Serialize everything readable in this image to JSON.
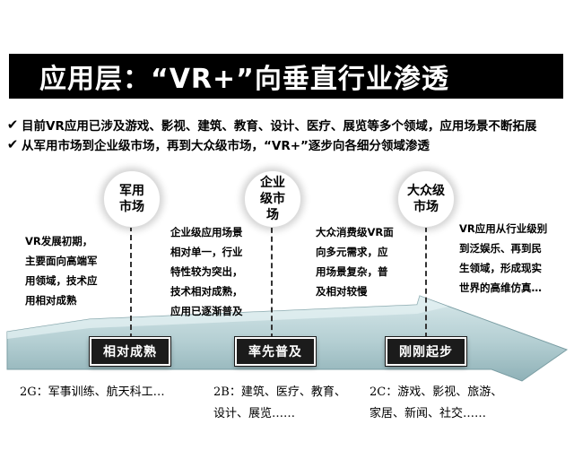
{
  "title": "应用层：“VR+”向垂直行业渗透",
  "bullets": [
    "目前VR应用已涉及游戏、影视、建筑、教育、设计、医疗、展览等多个领域，应用场景不断拓展",
    "从军用市场到企业级市场，再到大众级市场，“VR+”逐步向各细分领域渗透"
  ],
  "bullet_icon": "checkmark-icon",
  "stages": [
    {
      "market": "军用\n市场",
      "description": "VR发展初期，\n主要面向高端军\n用领域，技术应\n用相对成熟",
      "phase": "相对成熟",
      "examples": "2G：军事训练、航天科工…"
    },
    {
      "market": "企业\n级市\n场",
      "description": "企业级应用场景\n相对单一，行业\n特性较为突出，\n技术相对成熟，\n应用已逐渐普及",
      "phase": "率先普及",
      "examples": "2B：建筑、医疗、教育、\n设计、展览……"
    },
    {
      "market": "大众级\n市场",
      "description": "大众消费级VR面\n向多元需求，应\n用场景复杂，普\n及相对较慢",
      "phase": "刚刚起步",
      "examples": "2C：游戏、影视、旅游、\n家居、新闻、社交……"
    }
  ],
  "future_description": "VR应用从行业级别\n到泛娱乐、再到民\n生领域，形成现实\n世界的高维仿真…",
  "colors": {
    "title_bg": "#000000",
    "arrow_top": "#cfe3e6",
    "arrow_bottom": "#93b6bc",
    "box_bg": "#1b1b1b"
  }
}
